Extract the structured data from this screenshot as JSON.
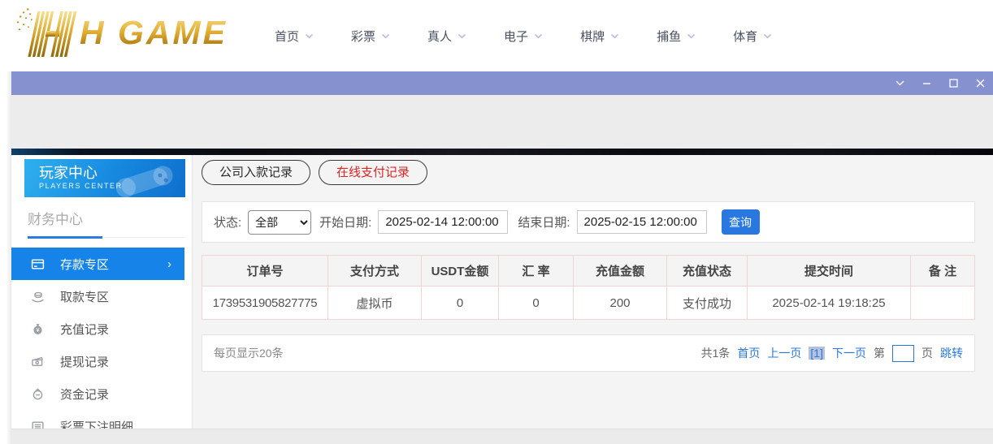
{
  "logo": {
    "text": "H GAME"
  },
  "nav": {
    "items": [
      {
        "label": "首页"
      },
      {
        "label": "彩票"
      },
      {
        "label": "真人"
      },
      {
        "label": "电子"
      },
      {
        "label": "棋牌"
      },
      {
        "label": "捕鱼"
      },
      {
        "label": "体育"
      }
    ]
  },
  "titlebar": {
    "controls": [
      "chevron-down-icon",
      "minimize-icon",
      "maximize-icon",
      "close-icon"
    ]
  },
  "sidebar": {
    "title": "玩家中心",
    "subtitle": "PLAYERS CENTER",
    "section": "财务中心",
    "items": [
      {
        "label": "存款专区",
        "icon": "bank-card-icon",
        "active": true
      },
      {
        "label": "取款专区",
        "icon": "hand-coin-icon"
      },
      {
        "label": "充值记录",
        "icon": "money-bag-icon"
      },
      {
        "label": "提现记录",
        "icon": "banknote-icon"
      },
      {
        "label": "资金记录",
        "icon": "coin-purse-icon"
      },
      {
        "label": "彩票下注明细",
        "icon": "list-icon"
      }
    ]
  },
  "glyphs": {
    "chevron_right": "›"
  },
  "tabs": [
    {
      "label": "公司入款记录",
      "active": false
    },
    {
      "label": "在线支付记录",
      "active": true
    }
  ],
  "filters": {
    "status_label": "状态:",
    "status_value": "全部",
    "start_label": "开始日期:",
    "start_value": "2025-02-14 12:00:00",
    "end_label": "结束日期:",
    "end_value": "2025-02-15 12:00:00",
    "query_button": "查询"
  },
  "table": {
    "headers": [
      "订单号",
      "支付方式",
      "USDT金额",
      "汇 率",
      "充值金额",
      "充值状态",
      "提交时间",
      "备 注"
    ],
    "rows": [
      [
        "1739531905827775",
        "虚拟币",
        "0",
        "0",
        "200",
        "支付成功",
        "2025-02-14 19:18:25",
        ""
      ]
    ]
  },
  "pagination": {
    "page_size_text": "每页显示20条",
    "total_text": "共1条",
    "first": "首页",
    "prev": "上一页",
    "current": "[1]",
    "next": "下一页",
    "jump_prefix": "第",
    "jump_suffix": "页",
    "jump_action": "跳转"
  },
  "colors": {
    "titlebar": "#8691d0",
    "accent_blue": "#2878e0",
    "sidebar_active": "#1583e8",
    "tab_active_red": "#e02525",
    "gold": "#e2ac31",
    "table_border": "#f3d4d4"
  }
}
